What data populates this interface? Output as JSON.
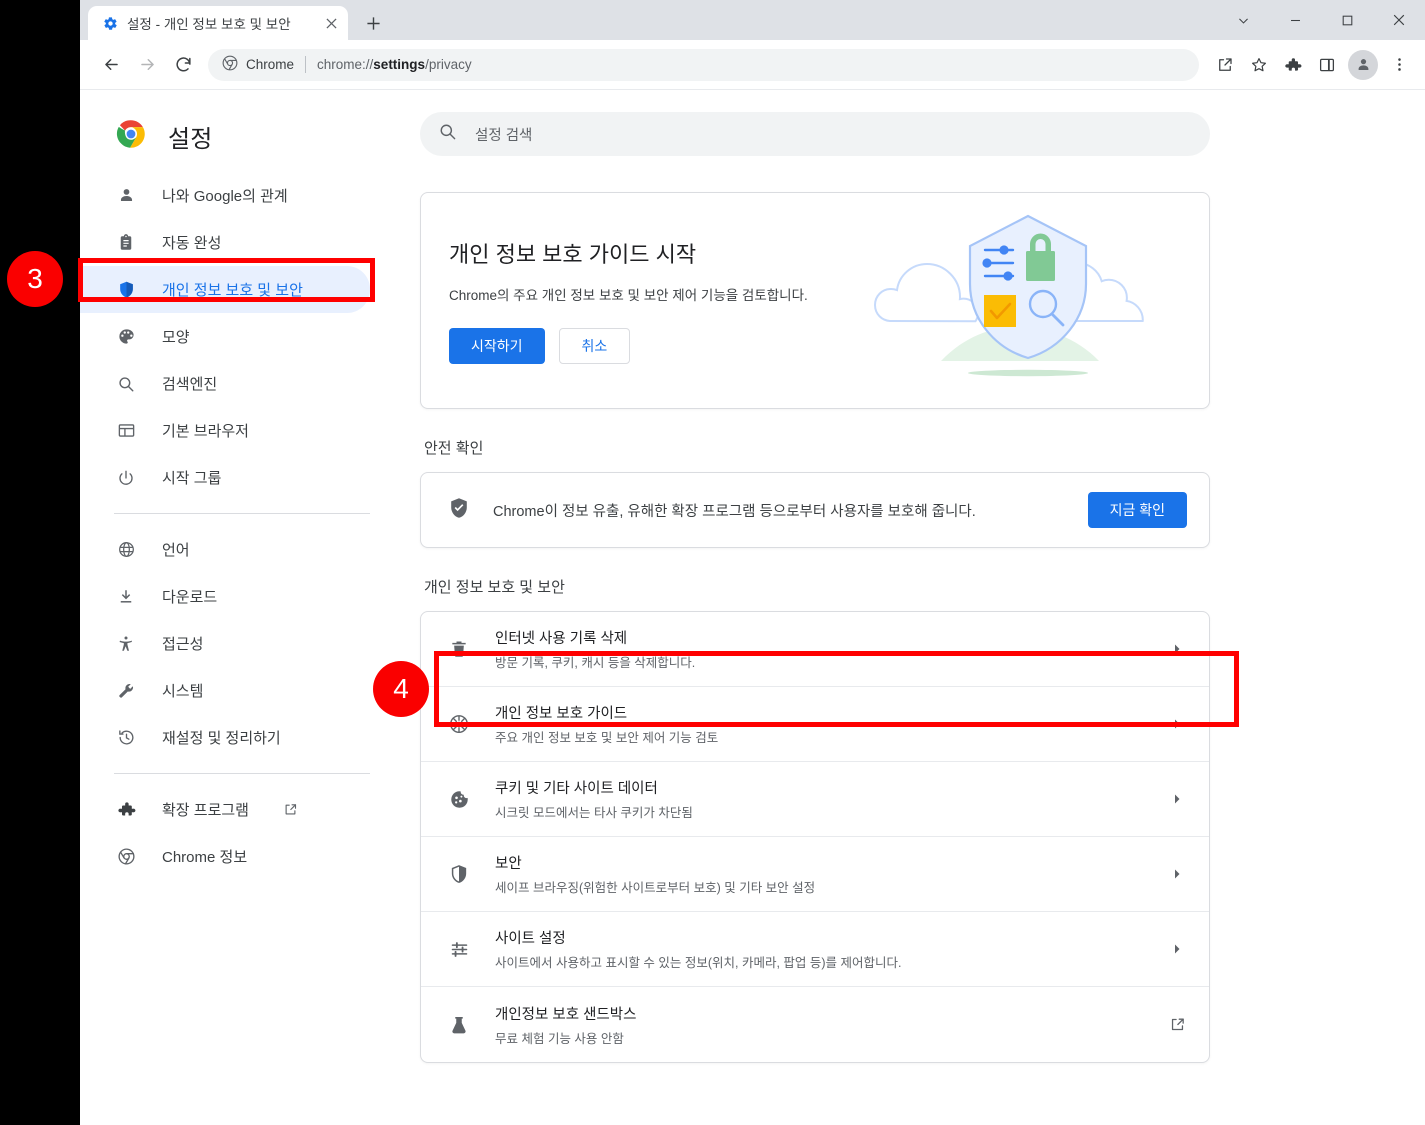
{
  "window": {
    "controls": [
      {
        "name": "chevron-down",
        "label": "∨"
      },
      {
        "name": "minimize",
        "label": "–"
      },
      {
        "name": "maximize",
        "label": "□"
      },
      {
        "name": "close",
        "label": "✕"
      }
    ]
  },
  "tab": {
    "title": "설정 - 개인 정보 보호 및 보안",
    "close_label": "✕",
    "new_tab_label": "+"
  },
  "toolbar": {
    "back_label": "←",
    "forward_label": "→",
    "reload_label": "↻",
    "omnibox_chip": "Chrome",
    "url_prefix": "chrome://",
    "url_bold": "settings",
    "url_suffix": "/privacy",
    "icons": [
      "share-icon",
      "bookmark-star-icon",
      "extensions-puzzle-icon",
      "side-panel-icon",
      "profile-avatar-icon",
      "chrome-menu-icon"
    ]
  },
  "sidebar": {
    "brand_title": "설정",
    "groups": [
      {
        "items": [
          {
            "icon": "person-icon",
            "label": "나와 Google의 관계",
            "active": false
          },
          {
            "icon": "autofill-clipboard-icon",
            "label": "자동 완성",
            "active": false
          },
          {
            "icon": "shield-icon",
            "label": "개인 정보 보호 및 보안",
            "active": true
          },
          {
            "icon": "palette-icon",
            "label": "모양",
            "active": false
          },
          {
            "icon": "search-icon",
            "label": "검색엔진",
            "active": false
          },
          {
            "icon": "browser-window-icon",
            "label": "기본 브라우저",
            "active": false
          },
          {
            "icon": "power-icon",
            "label": "시작 그룹",
            "active": false
          }
        ]
      },
      {
        "items": [
          {
            "icon": "globe-icon",
            "label": "언어",
            "active": false
          },
          {
            "icon": "download-icon",
            "label": "다운로드",
            "active": false
          },
          {
            "icon": "accessibility-icon",
            "label": "접근성",
            "active": false
          },
          {
            "icon": "wrench-icon",
            "label": "시스템",
            "active": false
          },
          {
            "icon": "restore-history-icon",
            "label": "재설정 및 정리하기",
            "active": false
          }
        ]
      },
      {
        "items": [
          {
            "icon": "puzzle-icon",
            "label": "확장 프로그램",
            "active": false,
            "external": true
          },
          {
            "icon": "chrome-logo-icon",
            "label": "Chrome 정보",
            "active": false
          }
        ]
      }
    ]
  },
  "search": {
    "placeholder": "설정 검색",
    "value": ""
  },
  "promo": {
    "heading": "개인 정보 보호 가이드 시작",
    "body": "Chrome의 주요 개인 정보 보호 및 보안 제어 기능을 검토합니다.",
    "primary_label": "시작하기",
    "secondary_label": "취소"
  },
  "safety_check": {
    "section_title": "안전 확인",
    "message": "Chrome이 정보 유출, 유해한 확장 프로그램 등으로부터 사용자를 보호해 줍니다.",
    "button_label": "지금 확인"
  },
  "privacy_section": {
    "section_title": "개인 정보 보호 및 보안",
    "rows": [
      {
        "icon": "trash-icon",
        "title": "인터넷 사용 기록 삭제",
        "subtitle": "방문 기록, 쿠키, 캐시 등을 삭제합니다.",
        "action": "chevron"
      },
      {
        "icon": "privacy-guide-icon",
        "title": "개인 정보 보호 가이드",
        "subtitle": "주요 개인 정보 보호 및 보안 제어 기능 검토",
        "action": "chevron"
      },
      {
        "icon": "cookie-icon",
        "title": "쿠키 및 기타 사이트 데이터",
        "subtitle": "시크릿 모드에서는 타사 쿠키가 차단됨",
        "action": "chevron"
      },
      {
        "icon": "security-shield-icon",
        "title": "보안",
        "subtitle": "세이프 브라우징(위험한 사이트로부터 보호) 및 기타 보안 설정",
        "action": "chevron"
      },
      {
        "icon": "sliders-icon",
        "title": "사이트 설정",
        "subtitle": "사이트에서 사용하고 표시할 수 있는 정보(위치, 카메라, 팝업 등)를 제어합니다.",
        "action": "chevron"
      },
      {
        "icon": "flask-icon",
        "title": "개인정보 보호 샌드박스",
        "subtitle": "무료 체험 기능 사용 안함",
        "action": "external"
      }
    ]
  },
  "annotations": [
    {
      "label": "3",
      "target": "sidebar-item-privacy"
    },
    {
      "label": "4",
      "target": "row-clear-browsing-data"
    }
  ],
  "colors": {
    "accent": "#1a73e8",
    "annotation": "#fa0000",
    "active_bg": "#e8f0fe",
    "tabstrip_bg": "#dee1e6",
    "omnibox_bg": "#f1f3f4"
  }
}
